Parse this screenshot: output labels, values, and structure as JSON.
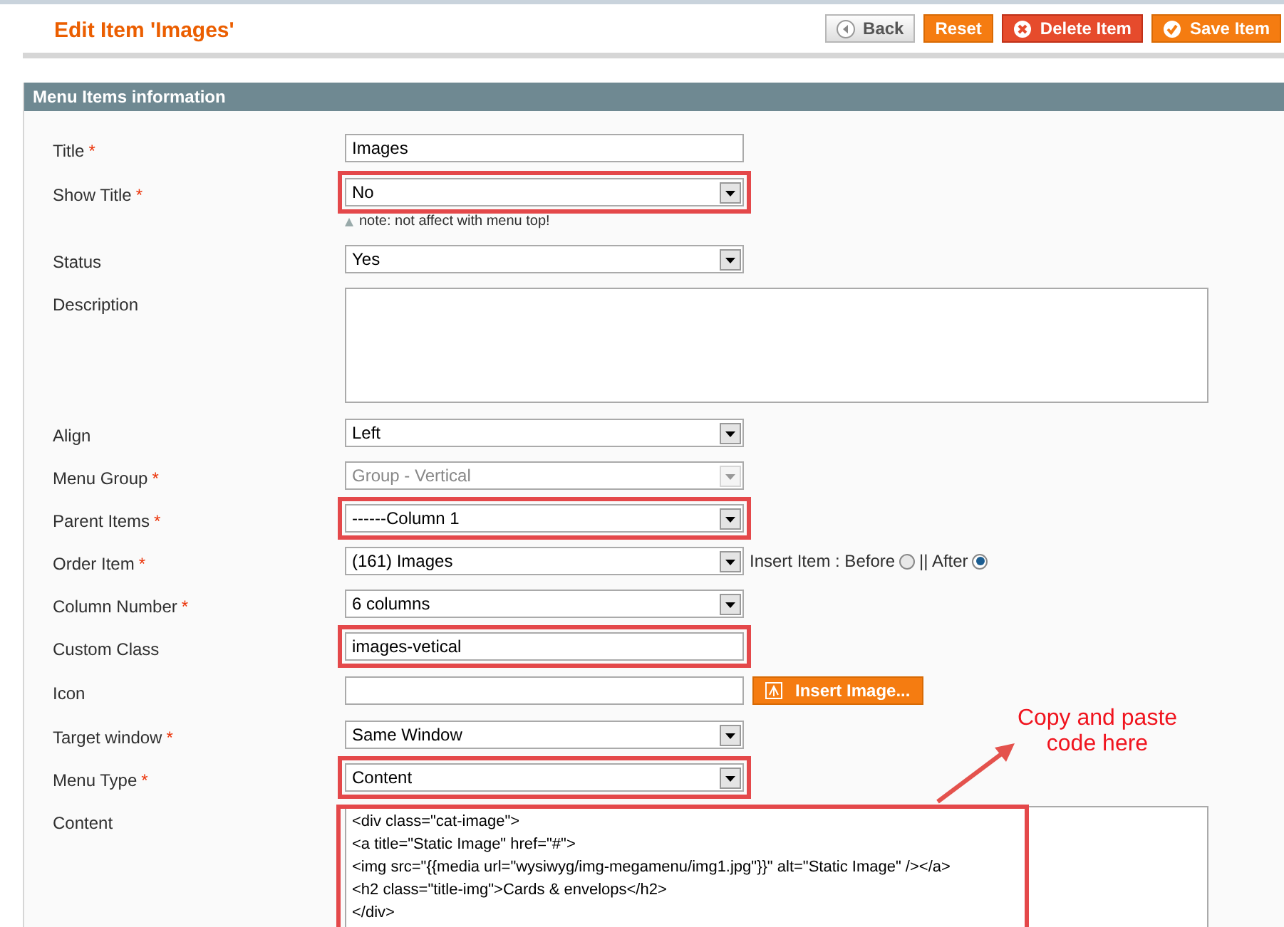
{
  "page_title": "Edit Item 'Images'",
  "buttons": [
    {
      "label": "Back",
      "kind": "back"
    },
    {
      "label": "Reset",
      "kind": "plain"
    },
    {
      "label": "Delete Item",
      "kind": "delete"
    },
    {
      "label": "Save Item",
      "kind": "save"
    }
  ],
  "section_title": "Menu Items information",
  "required_mark": "*",
  "fields": [
    {
      "label": "Title",
      "required": true,
      "kind": "text",
      "value": "Images",
      "highlighted": false
    },
    {
      "label": "Show Title",
      "required": true,
      "kind": "select",
      "value": "No",
      "highlighted": true,
      "note": "note: not affect with menu top!"
    },
    {
      "label": "Status",
      "required": false,
      "kind": "select",
      "value": "Yes",
      "highlighted": false
    },
    {
      "label": "Description",
      "required": false,
      "kind": "textarea",
      "highlighted": false
    },
    {
      "label": "Align",
      "required": false,
      "kind": "select",
      "value": "Left",
      "highlighted": false
    },
    {
      "label": "Menu Group",
      "required": true,
      "kind": "select",
      "value": "Group - Vertical",
      "highlighted": false,
      "disabled": true
    },
    {
      "label": "Parent Items",
      "required": true,
      "kind": "select",
      "value": "------Column 1",
      "highlighted": true
    },
    {
      "label": "Order Item",
      "required": true,
      "kind": "select",
      "value": "(161) Images",
      "highlighted": false,
      "insert_label": "Insert Item : Before",
      "insert_options": [
        {
          "selected": false
        },
        {
          "label": "|| After",
          "selected": true
        }
      ]
    },
    {
      "label": "Column Number",
      "required": true,
      "kind": "select",
      "value": "6 columns",
      "highlighted": false
    },
    {
      "label": "Custom Class",
      "required": false,
      "kind": "text",
      "value": "images-vetical",
      "highlighted": true
    },
    {
      "label": "Icon",
      "required": false,
      "kind": "text",
      "highlighted": false,
      "button": "Insert Image..."
    },
    {
      "label": "Target window",
      "required": true,
      "kind": "select",
      "value": "Same Window",
      "highlighted": false
    },
    {
      "label": "Menu Type",
      "required": true,
      "kind": "select",
      "value": "Content",
      "highlighted": true
    },
    {
      "label": "Content",
      "required": false,
      "kind": "code",
      "highlighted": true,
      "lines": [
        "<div class=\"cat-image\">",
        "<a title=\"Static Image\" href=\"#\">",
        "<img src=\"{{media url=\"wysiwyg/img-megamenu/img1.jpg\"}}\" alt=\"Static Image\" /></a>",
        "<h2 class=\"title-img\">Cards & envelops</h2>",
        "</div>"
      ]
    }
  ],
  "callout": "Copy and paste code here"
}
